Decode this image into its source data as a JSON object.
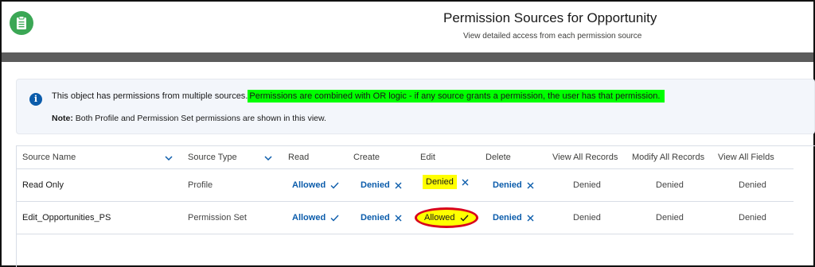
{
  "header": {
    "title": "Permission Sources for Opportunity",
    "subtitle": "View detailed access from each permission source",
    "app_icon": "clipboard-icon"
  },
  "info": {
    "icon": "info-icon",
    "text_plain": "This object has permissions from multiple sources.",
    "text_highlight": "Permissions are combined with OR logic - if any source grants a permission, the user has that permission.",
    "note_label": "Note:",
    "note_text": "Both Profile and Permission Set permissions are shown in this view."
  },
  "table": {
    "columns": [
      "Source Name",
      "Source Type",
      "Read",
      "Create",
      "Edit",
      "Delete",
      "View All Records",
      "Modify All Records",
      "View All Fields"
    ],
    "rows": [
      {
        "source_name": "Read Only",
        "source_type": "Profile",
        "read": "Allowed",
        "create": "Denied",
        "edit": "Denied",
        "delete": "Denied",
        "view_all_records": "Denied",
        "modify_all_records": "Denied",
        "view_all_fields": "Denied"
      },
      {
        "source_name": "Edit_Opportunities_PS",
        "source_type": "Permission Set",
        "read": "Allowed",
        "create": "Denied",
        "edit": "Allowed",
        "delete": "Denied",
        "view_all_records": "Denied",
        "modify_all_records": "Denied",
        "view_all_fields": "Denied"
      }
    ]
  },
  "colors": {
    "brand_blue": "#0b5cab",
    "app_green": "#3ba755",
    "highlight_green": "#00ff00",
    "highlight_yellow": "#ffff00",
    "annotation_red": "#d9001b"
  }
}
